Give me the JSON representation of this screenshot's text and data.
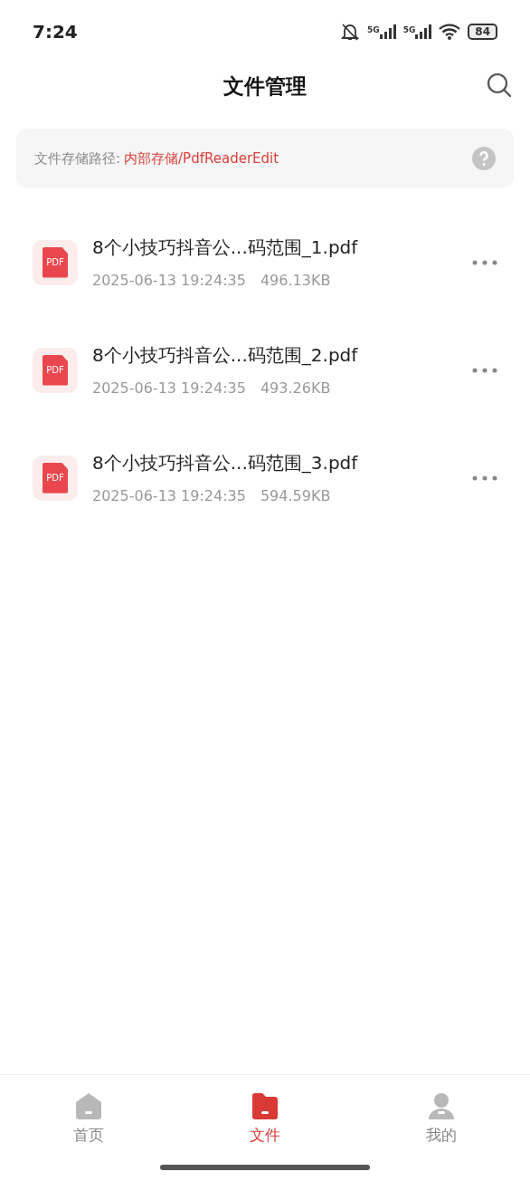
{
  "status_bar": {
    "time": "7:24",
    "network_1": "5G",
    "network_2": "5G",
    "battery": "84"
  },
  "header": {
    "title": "文件管理"
  },
  "storage_path": {
    "label": "文件存储路径:",
    "path": "内部存储/PdfReaderEdit"
  },
  "files": [
    {
      "icon_text": "PDF",
      "name": "8个小技巧抖音公...码范围_1.pdf",
      "date": "2025-06-13 19:24:35",
      "size": "496.13KB"
    },
    {
      "icon_text": "PDF",
      "name": "8个小技巧抖音公...码范围_2.pdf",
      "date": "2025-06-13 19:24:35",
      "size": "493.26KB"
    },
    {
      "icon_text": "PDF",
      "name": "8个小技巧抖音公...码范围_3.pdf",
      "date": "2025-06-13 19:24:35",
      "size": "594.59KB"
    }
  ],
  "bottom_nav": [
    {
      "kind": "home",
      "label": "首页",
      "selected": false
    },
    {
      "kind": "folder",
      "label": "文件",
      "selected": true
    },
    {
      "kind": "profile",
      "label": "我的",
      "selected": false
    }
  ]
}
